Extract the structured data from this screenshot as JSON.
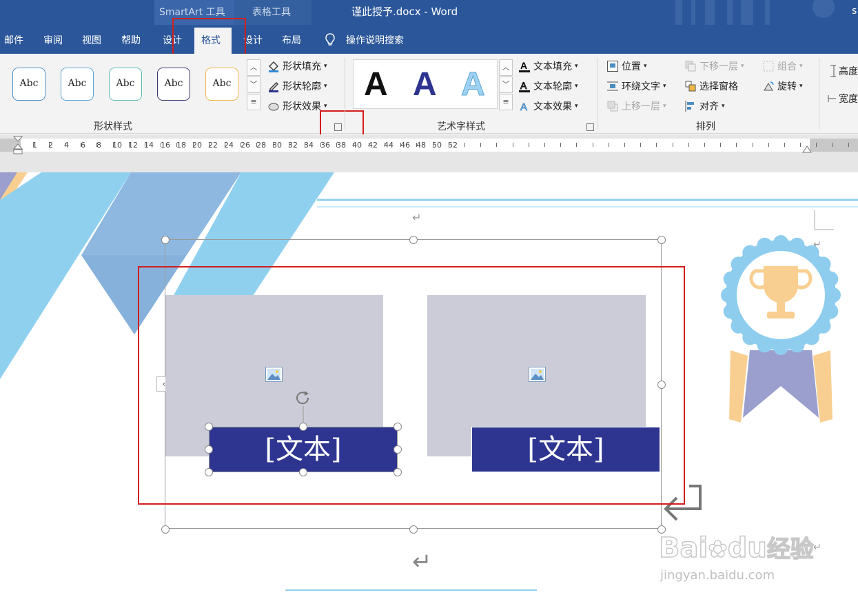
{
  "window": {
    "doc_title": "谨此授予.docx  -  Word",
    "user_initial": "s",
    "contextual_groups": [
      "SmartArt 工具",
      "表格工具"
    ]
  },
  "tabs": [
    "邮件",
    "审阅",
    "视图",
    "帮助",
    "设计",
    "格式",
    "设计",
    "布局"
  ],
  "active_tab": "格式",
  "tell_me": "操作说明搜索",
  "ribbon": {
    "shape_styles": {
      "gallery": [
        {
          "label": "Abc",
          "color": "#4a8ec2"
        },
        {
          "label": "Abc",
          "color": "#5aa7d6"
        },
        {
          "label": "Abc",
          "color": "#5bbdb6"
        },
        {
          "label": "Abc",
          "color": "#3a3c6e"
        },
        {
          "label": "Abc",
          "color": "#f2b74a"
        }
      ],
      "commands": [
        "形状填充",
        "形状轮廓",
        "形状效果"
      ],
      "group_label": "形状样式"
    },
    "wordart_styles": {
      "letters": [
        {
          "label": "A",
          "color": "#111111"
        },
        {
          "label": "A",
          "color": "#2e3591"
        },
        {
          "label": "A",
          "color": "#9fd1f2"
        }
      ],
      "commands": [
        "文本填充",
        "文本轮廓",
        "文本效果"
      ],
      "group_label": "艺术字样式"
    },
    "arrange": {
      "commands": [
        {
          "label": "位置",
          "enabled": true
        },
        {
          "label": "下移一层",
          "enabled": false
        },
        {
          "label": "组合",
          "enabled": false
        },
        {
          "label": "环绕文字",
          "enabled": true
        },
        {
          "label": "选择窗格",
          "enabled": true
        },
        {
          "label": "旋转",
          "enabled": true
        },
        {
          "label": "上移一层",
          "enabled": false
        },
        {
          "label": "对齐",
          "enabled": true
        }
      ],
      "group_label": "排列"
    },
    "size": {
      "commands": [
        "高度",
        "宽度"
      ]
    }
  },
  "ruler": {
    "labels": [
      "1",
      "2",
      "4",
      "6",
      "8",
      "10",
      "12",
      "14",
      "16",
      "18",
      "20",
      "22",
      "24",
      "26",
      "28",
      "30",
      "32",
      "34",
      "36",
      "38",
      "40",
      "42",
      "44",
      "46",
      "48",
      "50",
      "52"
    ]
  },
  "smartart": {
    "items": [
      {
        "text": "[文本]"
      },
      {
        "text": "[文本]"
      }
    ]
  },
  "watermark": {
    "brand": "Bai",
    "brand2": "du",
    "brand_cn": "经验",
    "url": "jingyan.baidu.com"
  },
  "colors": {
    "accent_blue": "#2b579a",
    "highlight_red": "#d31d1d",
    "text_box": "#2e3591",
    "badge_light": "#8fcdee",
    "trophy": "#f8cf90"
  }
}
